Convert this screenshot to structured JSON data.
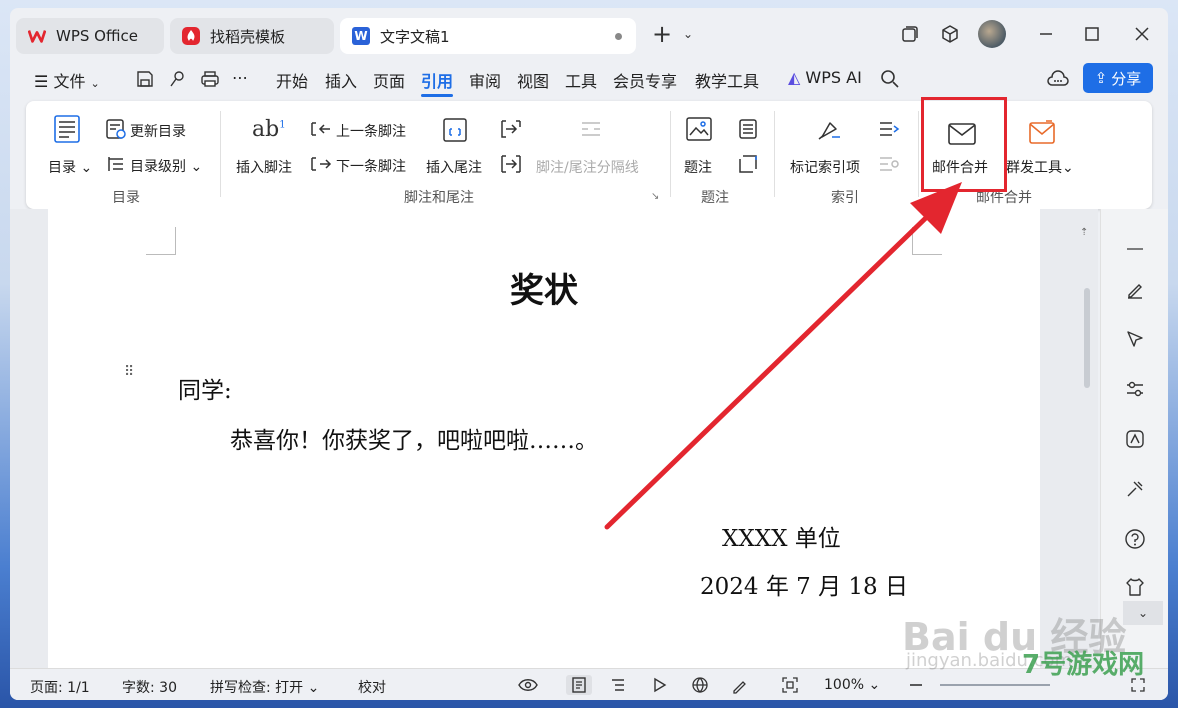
{
  "tabs": [
    {
      "label": "WPS Office",
      "icon": "wps-logo-icon"
    },
    {
      "label": "找稻壳模板",
      "icon": "docer-icon"
    },
    {
      "label": "文字文稿1",
      "icon": "word-doc-icon"
    }
  ],
  "menu": {
    "file": "文件",
    "items": [
      "开始",
      "插入",
      "页面",
      "引用",
      "审阅",
      "视图",
      "工具",
      "会员专享",
      "教学工具"
    ],
    "active": "引用",
    "wps_ai": "WPS AI",
    "share": "分享"
  },
  "ribbon": {
    "toc": {
      "toc_btn": "目录",
      "update_toc": "更新目录",
      "toc_level": "目录级别",
      "group": "目录"
    },
    "footnote": {
      "insert_footnote": "插入脚注",
      "prev_footnote": "上一条脚注",
      "next_footnote": "下一条脚注",
      "insert_endnote": "插入尾注",
      "separator": "脚注/尾注分隔线",
      "group": "脚注和尾注"
    },
    "caption": {
      "caption": "题注",
      "group": "题注"
    },
    "index": {
      "mark_entry": "标记索引项",
      "group": "索引"
    },
    "mailmerge": {
      "mail_merge": "邮件合并",
      "mass_tools": "群发工具",
      "group": "邮件合并"
    }
  },
  "document": {
    "title": "奖状",
    "salutation": "同学:",
    "body": "恭喜你！你获奖了，吧啦吧啦……。",
    "org": "XXXX 单位",
    "date": "2024 年 7 月 18 日"
  },
  "status": {
    "page": "页面: 1/1",
    "words": "字数: 30",
    "spell": "拼写检查: 打开",
    "proof": "校对",
    "zoom": "100%"
  },
  "watermark": {
    "baidu": "Bai du 经验",
    "jingyan": "jingyan.baidu.com",
    "site": "7号游戏网"
  },
  "colors": {
    "accent": "#1e6ee6",
    "highlight": "#e3262f"
  }
}
